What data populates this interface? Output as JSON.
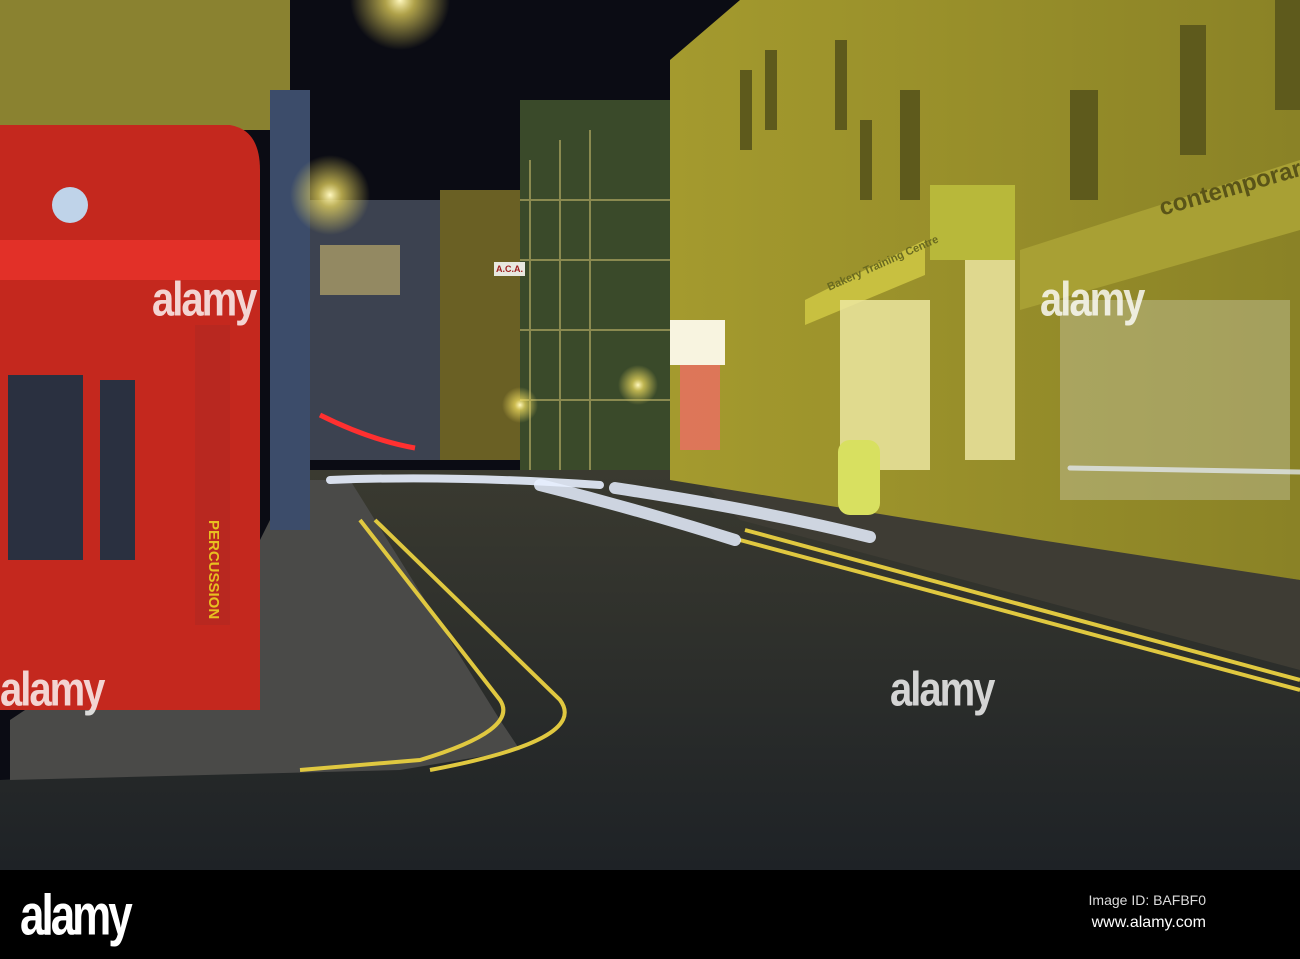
{
  "photo": {
    "signs": {
      "contemporary": "contemporary",
      "percussion": "PERCUSSION",
      "training_centre": "Bakery Training Centre",
      "aca": "A.C.A."
    },
    "watermark": "alamy"
  },
  "footer": {
    "logo": "alamy",
    "image_id": "Image ID: BAFBF0",
    "url": "www.alamy.com"
  }
}
